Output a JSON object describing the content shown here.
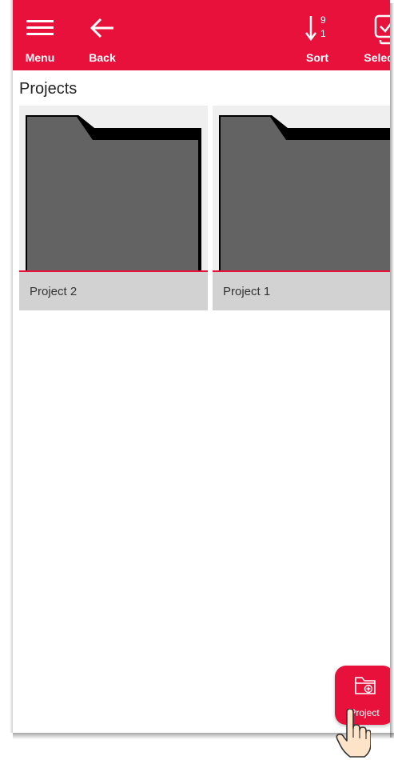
{
  "colors": {
    "accent": "#e8113b",
    "folder": "#636363",
    "caption_bg": "#d2d2d2"
  },
  "toolbar": {
    "menu": {
      "label": "Menu",
      "icon": "menu-icon"
    },
    "back": {
      "label": "Back",
      "icon": "arrow-left-icon"
    },
    "sort": {
      "label": "Sort",
      "icon": "sort-descending-icon",
      "top_digit": "9",
      "bottom_digit": "1"
    },
    "select": {
      "label": "Select",
      "icon": "checkbox-multiple-icon"
    }
  },
  "page": {
    "title": "Projects"
  },
  "projects": [
    {
      "name": "Project 2",
      "icon": "folder-icon"
    },
    {
      "name": "Project 1",
      "icon": "folder-icon"
    }
  ],
  "fab": {
    "label": "Project",
    "icon": "folder-plus-icon"
  },
  "pointer": {
    "icon": "hand-pointer-icon"
  }
}
